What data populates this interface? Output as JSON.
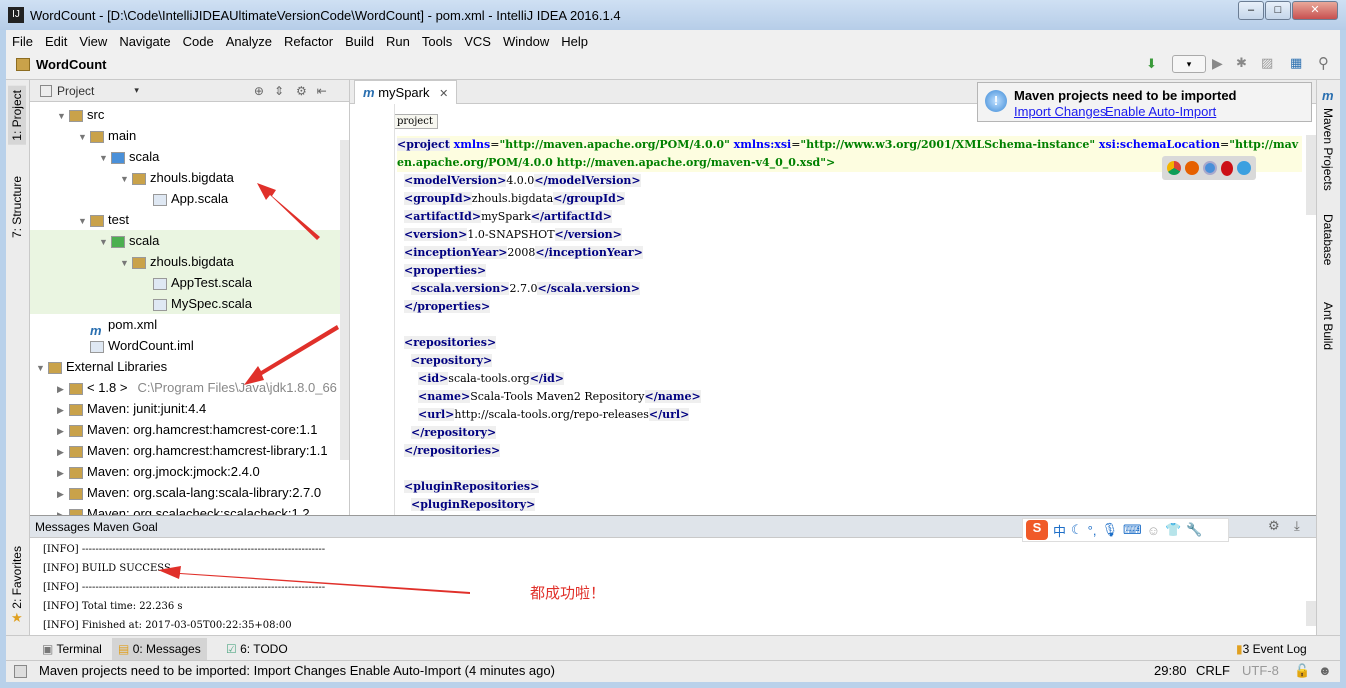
{
  "window": {
    "title": "WordCount - [D:\\Code\\IntelliJIDEAUltimateVersionCode\\WordCount] - pom.xml - IntelliJ IDEA 2016.1.4",
    "minimize": "–",
    "maximize": "□",
    "close": "✕"
  },
  "menu": [
    "File",
    "Edit",
    "View",
    "Navigate",
    "Code",
    "Analyze",
    "Refactor",
    "Build",
    "Run",
    "Tools",
    "VCS",
    "Window",
    "Help"
  ],
  "breadcrumb": "WordCount",
  "left_strip": {
    "project": "1: Project",
    "structure": "7: Structure",
    "favorites": "2: Favorites"
  },
  "right_strip": {
    "maven": "Maven Projects",
    "database": "Database",
    "ant": "Ant Build"
  },
  "project_panel": {
    "view": "Project",
    "tree": [
      {
        "label": "src",
        "indent": 1,
        "expand": "▼",
        "icon": "folder"
      },
      {
        "label": "main",
        "indent": 2,
        "expand": "▼",
        "icon": "folder"
      },
      {
        "label": "scala",
        "indent": 3,
        "expand": "▼",
        "icon": "source-folder"
      },
      {
        "label": "zhouls.bigdata",
        "indent": 4,
        "expand": "▼",
        "icon": "package"
      },
      {
        "label": "App.scala",
        "indent": 5,
        "expand": "",
        "icon": "file"
      },
      {
        "label": "test",
        "indent": 2,
        "expand": "▼",
        "icon": "folder"
      },
      {
        "label": "scala",
        "indent": 3,
        "expand": "▼",
        "icon": "test-folder",
        "green": true
      },
      {
        "label": "zhouls.bigdata",
        "indent": 4,
        "expand": "▼",
        "icon": "package",
        "green": true
      },
      {
        "label": "AppTest.scala",
        "indent": 5,
        "expand": "",
        "icon": "file",
        "green": true
      },
      {
        "label": "MySpec.scala",
        "indent": 5,
        "expand": "",
        "icon": "file",
        "green": true
      },
      {
        "label": "pom.xml",
        "indent": 2,
        "expand": "",
        "icon": "maven"
      },
      {
        "label": "WordCount.iml",
        "indent": 2,
        "expand": "",
        "icon": "file"
      },
      {
        "label": "External Libraries",
        "indent": 0,
        "expand": "▼",
        "icon": "library"
      },
      {
        "label": "< 1.8 >",
        "extra": "C:\\Program Files\\Java\\jdk1.8.0_66",
        "indent": 1,
        "expand": "▶",
        "icon": "jdk"
      },
      {
        "label": "Maven: junit:junit:4.4",
        "indent": 1,
        "expand": "▶",
        "icon": "library"
      },
      {
        "label": "Maven: org.hamcrest:hamcrest-core:1.1",
        "indent": 1,
        "expand": "▶",
        "icon": "library"
      },
      {
        "label": "Maven: org.hamcrest:hamcrest-library:1.1",
        "indent": 1,
        "expand": "▶",
        "icon": "library"
      },
      {
        "label": "Maven: org.jmock:jmock:2.4.0",
        "indent": 1,
        "expand": "▶",
        "icon": "library"
      },
      {
        "label": "Maven: org.scala-lang:scala-library:2.7.0",
        "indent": 1,
        "expand": "▶",
        "icon": "library"
      },
      {
        "label": "Maven: org.scalacheck:scalacheck:1.2",
        "indent": 1,
        "expand": "▶",
        "icon": "library"
      }
    ]
  },
  "editor": {
    "tab": "mySpark",
    "breadcrumb_tag": "project",
    "lines": [
      [
        [
          "tg",
          "<project"
        ],
        [
          "at",
          " xmlns"
        ],
        [
          "tx",
          "="
        ],
        [
          "av",
          "\"http://maven.apache.org/POM/4.0.0\""
        ],
        [
          "at",
          " xmlns:xsi"
        ],
        [
          "tx",
          "="
        ],
        [
          "av",
          "\"http://www.w3.org/2001/XMLSchema-instance\""
        ],
        [
          "at",
          " xsi:schemaLocation"
        ],
        [
          "tx",
          "="
        ],
        [
          "av",
          "\"http://maven.apache.org/POM/4.0.0 http://maven.apache.org/maven-v4_0_0.xsd\">"
        ]
      ],
      [
        [
          "tx",
          "  "
        ],
        [
          "tg",
          "<modelVersion>"
        ],
        [
          "tx",
          "4.0.0"
        ],
        [
          "tg",
          "</modelVersion>"
        ]
      ],
      [
        [
          "tx",
          "  "
        ],
        [
          "tg",
          "<groupId>"
        ],
        [
          "tx",
          "zhouls.bigdata"
        ],
        [
          "tg",
          "</groupId>"
        ]
      ],
      [
        [
          "tx",
          "  "
        ],
        [
          "tg",
          "<artifactId>"
        ],
        [
          "tx",
          "mySpark"
        ],
        [
          "tg",
          "</artifactId>"
        ]
      ],
      [
        [
          "tx",
          "  "
        ],
        [
          "tg",
          "<version>"
        ],
        [
          "tx",
          "1.0-SNAPSHOT"
        ],
        [
          "tg",
          "</version>"
        ]
      ],
      [
        [
          "tx",
          "  "
        ],
        [
          "tg",
          "<inceptionYear>"
        ],
        [
          "tx",
          "2008"
        ],
        [
          "tg",
          "</inceptionYear>"
        ]
      ],
      [
        [
          "tx",
          "  "
        ],
        [
          "tg",
          "<properties>"
        ]
      ],
      [
        [
          "tx",
          "    "
        ],
        [
          "tg",
          "<scala.version>"
        ],
        [
          "tx",
          "2.7.0"
        ],
        [
          "tg",
          "</scala.version>"
        ]
      ],
      [
        [
          "tx",
          "  "
        ],
        [
          "tg",
          "</properties>"
        ]
      ],
      [],
      [
        [
          "tx",
          "  "
        ],
        [
          "tg",
          "<repositories>"
        ]
      ],
      [
        [
          "tx",
          "    "
        ],
        [
          "tg",
          "<repository>"
        ]
      ],
      [
        [
          "tx",
          "      "
        ],
        [
          "tg",
          "<id>"
        ],
        [
          "tx",
          "scala-tools.org"
        ],
        [
          "tg",
          "</id>"
        ]
      ],
      [
        [
          "tx",
          "      "
        ],
        [
          "tg",
          "<name>"
        ],
        [
          "tx",
          "Scala-Tools Maven2 Repository"
        ],
        [
          "tg",
          "</name>"
        ]
      ],
      [
        [
          "tx",
          "      "
        ],
        [
          "tg",
          "<url>"
        ],
        [
          "tx",
          "http://scala-tools.org/repo-releases"
        ],
        [
          "tg",
          "</url>"
        ]
      ],
      [
        [
          "tx",
          "    "
        ],
        [
          "tg",
          "</repository>"
        ]
      ],
      [
        [
          "tx",
          "  "
        ],
        [
          "tg",
          "</repositories>"
        ]
      ],
      [],
      [
        [
          "tx",
          "  "
        ],
        [
          "tg",
          "<pluginRepositories>"
        ]
      ],
      [
        [
          "tx",
          "    "
        ],
        [
          "tg",
          "<pluginRepository>"
        ]
      ]
    ]
  },
  "notification": {
    "title": "Maven projects need to be imported",
    "import": "Import Changes",
    "auto": "Enable Auto-Import"
  },
  "browsers": [
    "chrome",
    "firefox",
    "safari",
    "opera",
    "ie"
  ],
  "messages": {
    "title": "Messages Maven Goal",
    "lines": [
      "[INFO] ------------------------------------------------------------------------",
      "[INFO] BUILD SUCCESS",
      "[INFO] ------------------------------------------------------------------------",
      "[INFO] Total time: 22.236 s",
      "[INFO] Finished at: 2017-03-05T00:22:35+08:00"
    ],
    "annotation": "都成功啦！"
  },
  "ime": {
    "lang": "中"
  },
  "tool_tabs": {
    "terminal": "Terminal",
    "messages": "0: Messages",
    "todo": "6: TODO",
    "event_count": "3",
    "event_log": "Event Log"
  },
  "status": {
    "text": "Maven projects need to be imported: Import Changes Enable Auto-Import (4 minutes ago)",
    "position": "29:80",
    "line_sep": "CRLF",
    "encoding": "UTF-8"
  }
}
